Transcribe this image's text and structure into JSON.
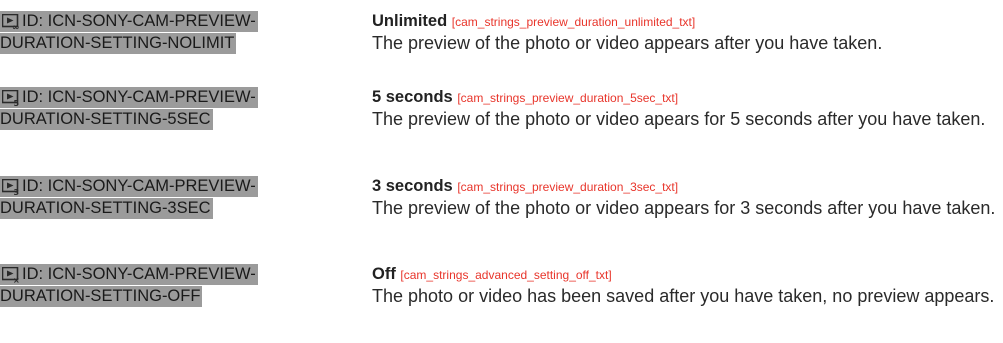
{
  "colors": {
    "id_highlight_bg": "#9b9b9b",
    "string_key": "#e8352b",
    "text": "#2a2a2a"
  },
  "entries": [
    {
      "icon": "preview-unlimited-icon",
      "id_line1": "ID: ICN-SONY-CAM-PREVIEW-",
      "id_line2": "DURATION-SETTING-NOLIMIT",
      "title": "Unlimited",
      "key": "[cam_strings_preview_duration_unlimited_txt]",
      "description": "The preview of the photo or video appears after you have taken."
    },
    {
      "icon": "preview-5sec-icon",
      "id_line1": "ID: ICN-SONY-CAM-PREVIEW-",
      "id_line2": "DURATION-SETTING-5SEC",
      "title": "5 seconds",
      "key": "[cam_strings_preview_duration_5sec_txt]",
      "description": "The preview of the photo or video apears for 5 seconds after you have taken."
    },
    {
      "icon": "preview-3sec-icon",
      "id_line1": "ID: ICN-SONY-CAM-PREVIEW-",
      "id_line2": "DURATION-SETTING-3SEC",
      "title": "3 seconds",
      "key": "[cam_strings_preview_duration_3sec_txt]",
      "description": "The preview of the photo or video appears for 3 seconds after you have taken."
    },
    {
      "icon": "preview-off-icon",
      "id_line1": "ID: ICN-SONY-CAM-PREVIEW-",
      "id_line2": "DURATION-SETTING-OFF",
      "title": "Off",
      "key": "[cam_strings_advanced_setting_off_txt]",
      "description": "The photo or video has been saved after you have taken, no preview appears."
    }
  ]
}
